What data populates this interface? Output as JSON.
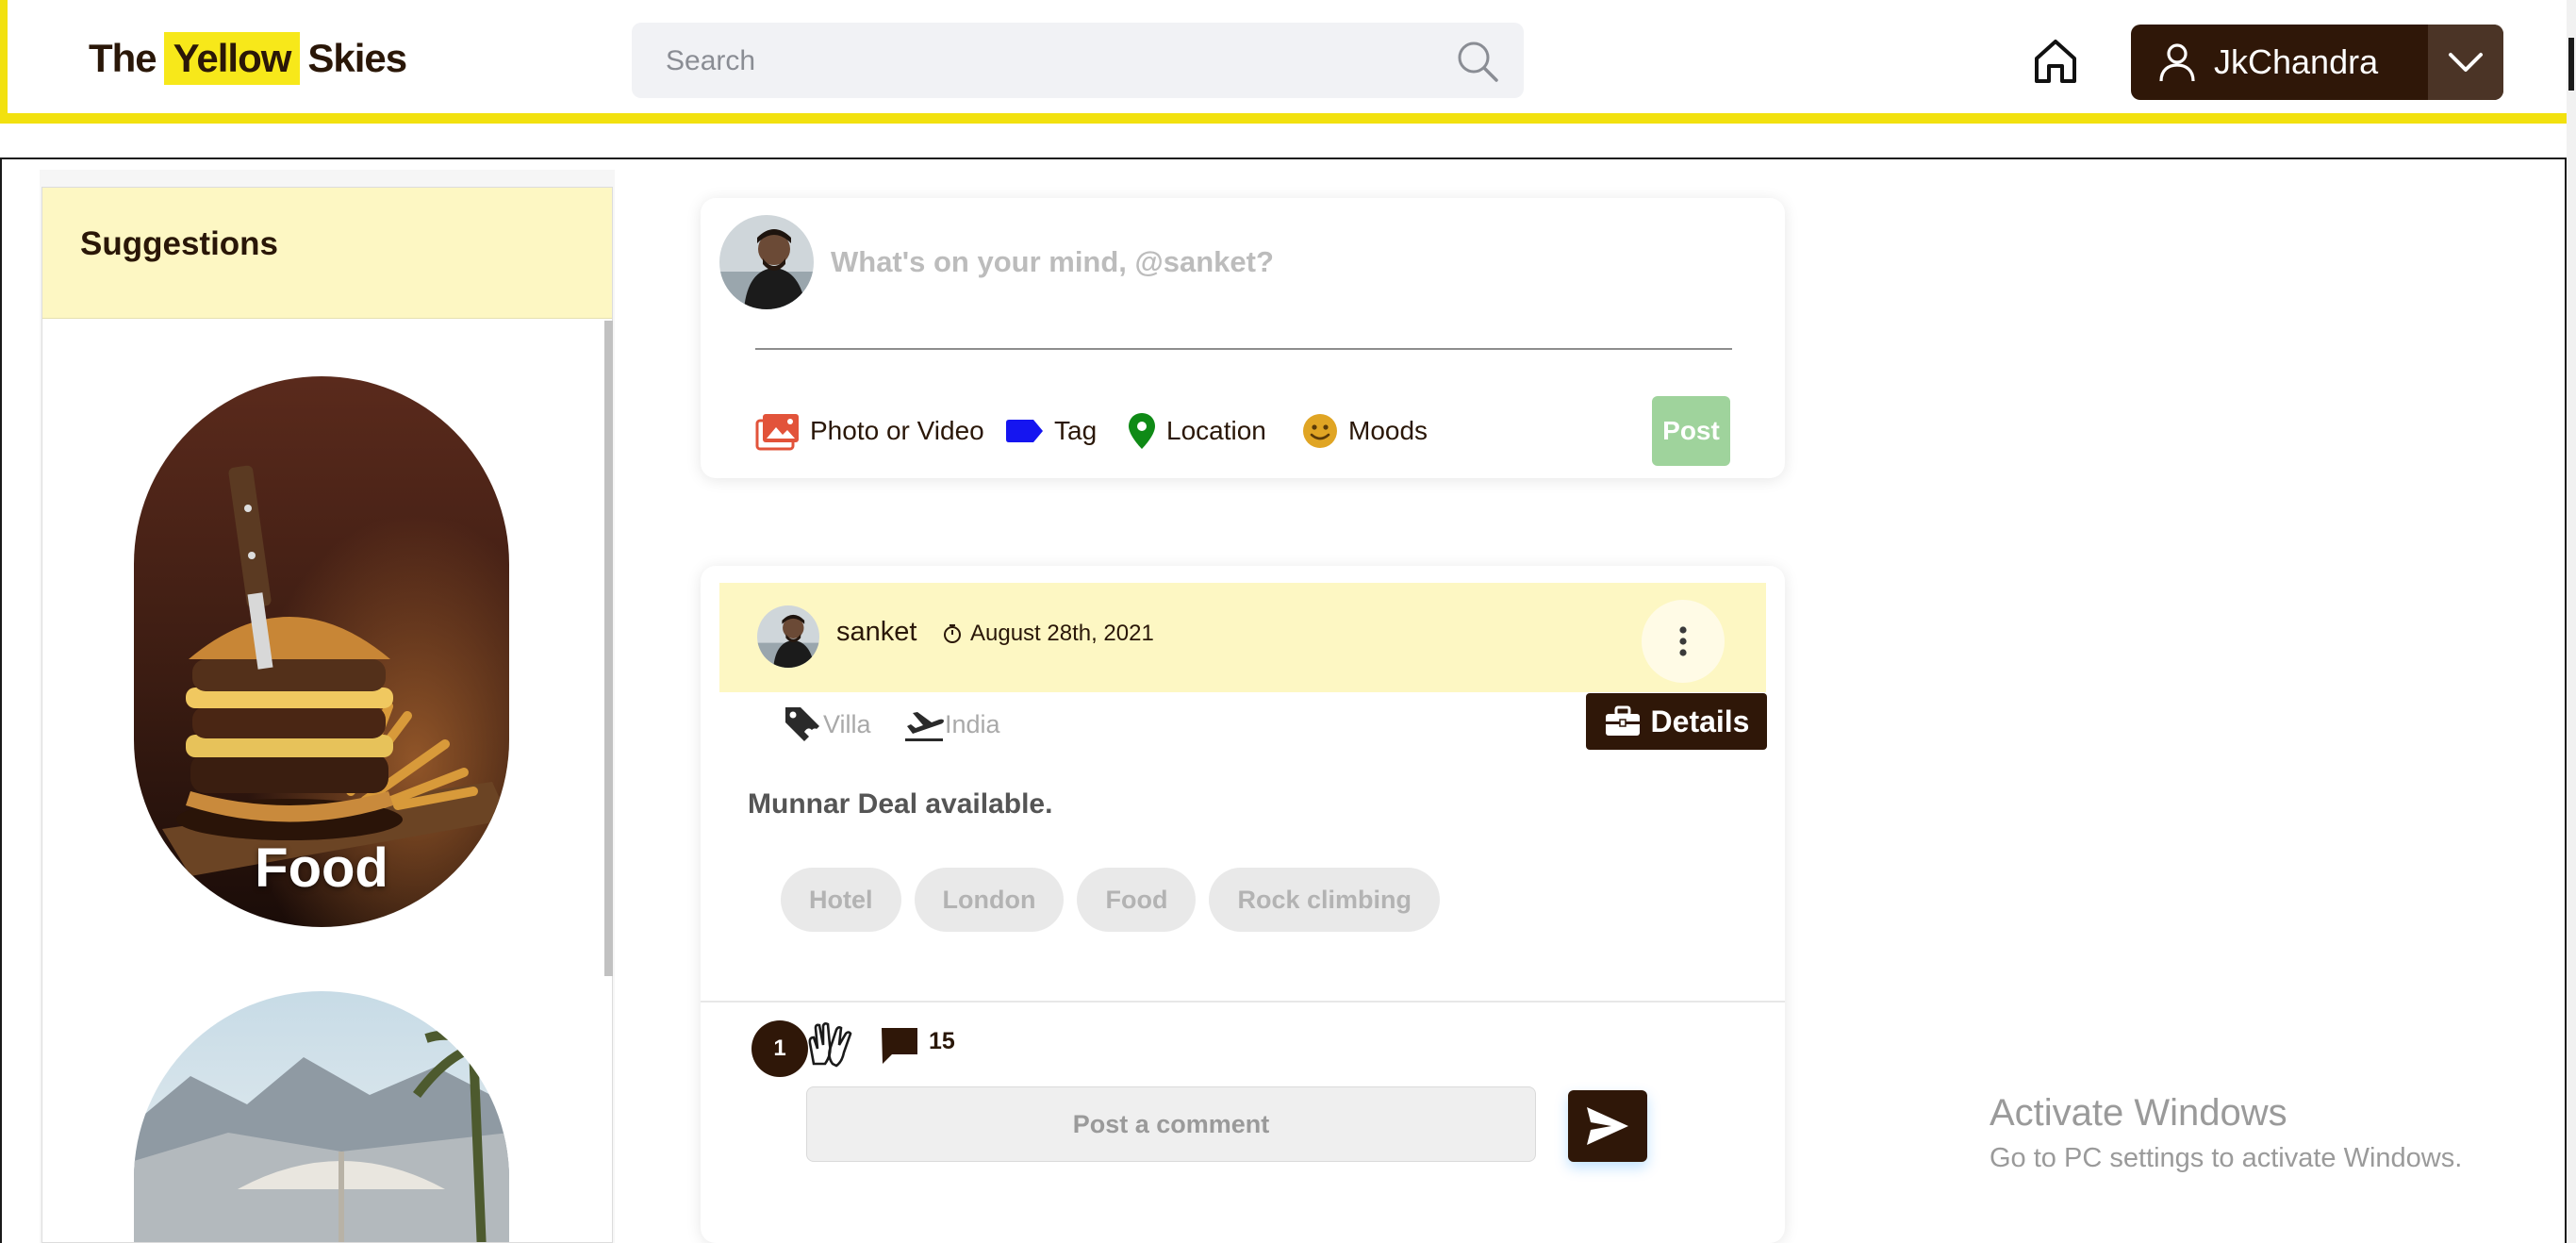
{
  "header": {
    "logo": {
      "part1": "The",
      "highlight": "Yellow",
      "part2": "Skies"
    },
    "search": {
      "placeholder": "Search"
    },
    "home_icon": "home-icon",
    "user": {
      "name": "JkChandra"
    }
  },
  "sidebar": {
    "title": "Suggestions",
    "items": [
      {
        "label": "Food"
      },
      {
        "label": ""
      }
    ]
  },
  "composer": {
    "prompt": "What's on your mind, @sanket?",
    "options": [
      {
        "label": "Photo or Video",
        "icon": "photo-icon",
        "color": "#e2533a"
      },
      {
        "label": "Tag",
        "icon": "tag-icon",
        "color": "#1515f0"
      },
      {
        "label": "Location",
        "icon": "location-pin-icon",
        "color": "#0f8a16"
      },
      {
        "label": "Moods",
        "icon": "smiley-icon",
        "color": "#e0a524"
      }
    ],
    "post_label": "Post"
  },
  "post": {
    "author": "sanket",
    "date": "August 28th, 2021",
    "meta": [
      {
        "icon": "tag-icon",
        "label": "Villa"
      },
      {
        "icon": "plane-departure-icon",
        "label": "India"
      }
    ],
    "details_label": "Details",
    "text": "Munnar Deal available.",
    "chips": [
      "Hotel",
      "London",
      "Food",
      "Rock climbing"
    ],
    "reactions": "1",
    "comments": "15",
    "comment_placeholder": "Post a comment"
  },
  "watermark": {
    "line1": "Activate Windows",
    "line2": "Go to PC settings to activate Windows."
  },
  "colors": {
    "accent_yellow": "#f2e10f",
    "brand_brown": "#2f1708",
    "pale_yellow": "#fdf7c3"
  }
}
